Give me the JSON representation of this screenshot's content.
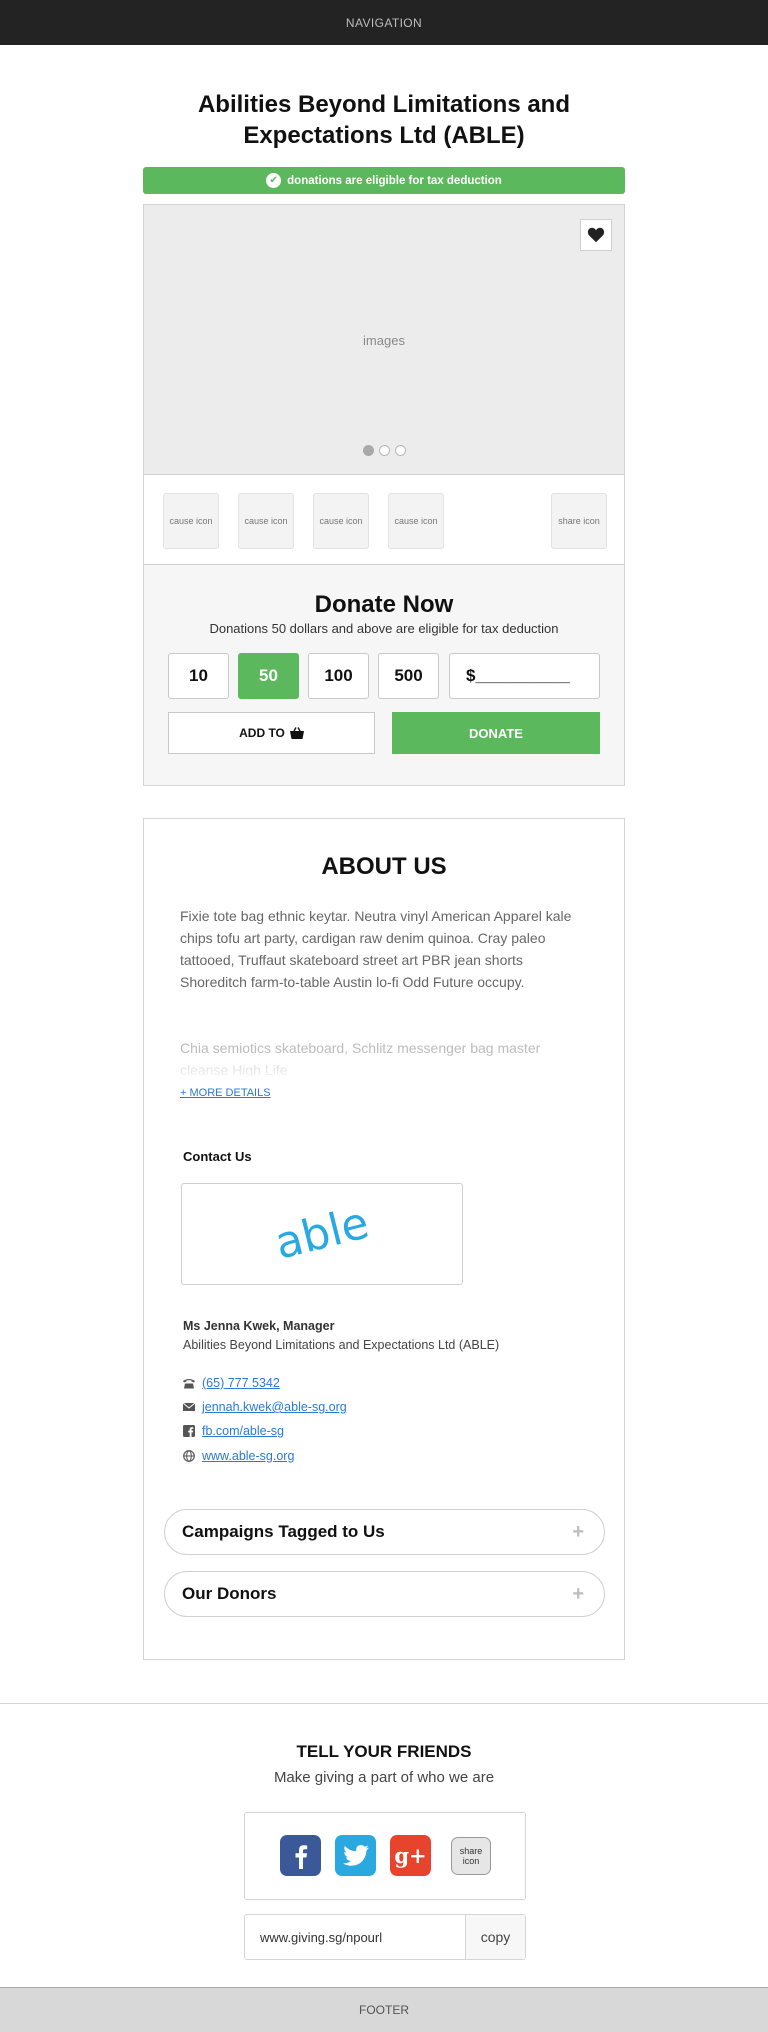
{
  "nav": {
    "label": "NAVIGATION"
  },
  "org": {
    "title": "Abilities Beyond Limitations and Expectations Ltd (ABLE)"
  },
  "tax_banner": {
    "text": "donations are eligible for tax deduction",
    "color": "#5cb85c"
  },
  "gallery": {
    "label": "images",
    "favorite_icon": "heart-icon",
    "slides": 3,
    "active_slide": 1
  },
  "cause_icons": [
    {
      "label": "cause icon"
    },
    {
      "label": "cause icon"
    },
    {
      "label": "cause icon"
    },
    {
      "label": "cause icon"
    }
  ],
  "share_icon": {
    "label": "share icon"
  },
  "donate": {
    "title": "Donate Now",
    "subtitle": "Donations 50 dollars  and above are eligible for tax deduction",
    "amounts": [
      "10",
      "50",
      "100",
      "500"
    ],
    "selected_amount": "50",
    "custom_placeholder": "$__________",
    "add_to_label": "ADD TO",
    "add_to_icon": "basket-icon",
    "donate_label": "DONATE",
    "accent": "#5cb85c"
  },
  "about": {
    "title": "ABOUT US",
    "paragraph1": "Fixie tote bag ethnic keytar. Neutra vinyl American Apparel kale chips tofu art party, cardigan raw denim quinoa. Cray paleo tattooed, Truffaut skateboard street art PBR jean shorts Shoreditch farm-to-table Austin lo-fi Odd Future occupy.",
    "paragraph2": "Chia semiotics skateboard, Schlitz messenger bag master cleanse High Life",
    "more_label": "+ MORE DETAILS"
  },
  "contact": {
    "heading": "Contact Us",
    "logo_text": "able",
    "logo_color": "#29a9e1",
    "name": "Ms Jenna Kwek, Manager",
    "org": "Abilities Beyond Limitations and Expectations Ltd (ABLE)",
    "phone": "(65) 777 5342",
    "email": "jennah.kwek@able-sg.org",
    "facebook": "fb.com/able-sg",
    "website": "www.able-sg.org"
  },
  "accordions": [
    {
      "label": "Campaigns Tagged to Us"
    },
    {
      "label": "Our Donors"
    }
  ],
  "share": {
    "title": "TELL YOUR FRIENDS",
    "subtitle": "Make giving a part of who we are",
    "facebook_color": "#3b5998",
    "twitter_color": "#2aa9e0",
    "googleplus_color": "#e8432d",
    "share_label": "share icon",
    "url": "www.giving.sg/npourl",
    "copy_label": "copy"
  },
  "footer": {
    "label": "FOOTER"
  }
}
